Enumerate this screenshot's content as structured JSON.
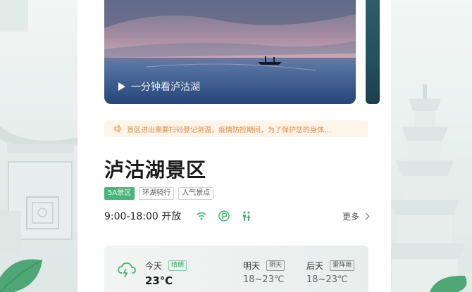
{
  "hero": {
    "caption": "一分钟看泸沽湖"
  },
  "notice": {
    "text": "景区进出需要扫码登记测温，疫情防控期间，为了保护您的身体…"
  },
  "scenic": {
    "title": "泸沽湖景区",
    "tags": [
      "5A景区",
      "环湖骑行",
      "人气景点"
    ],
    "hours": "9:00-18:00 开放",
    "more": "更多",
    "amenities": [
      "wifi-icon",
      "parking-icon",
      "restroom-icon"
    ]
  },
  "weather": {
    "today": {
      "label": "今天",
      "condition": "晴朗",
      "temp": "23℃"
    },
    "tomorrow": {
      "label": "明天",
      "condition": "阴天",
      "temp": "18~23℃"
    },
    "after": {
      "label": "后天",
      "condition": "雷阵雨",
      "temp": "18~23℃"
    }
  },
  "colors": {
    "accent": "#48b67a",
    "notice_text": "#e08a3c",
    "notice_bg": "#fdf4ea"
  }
}
